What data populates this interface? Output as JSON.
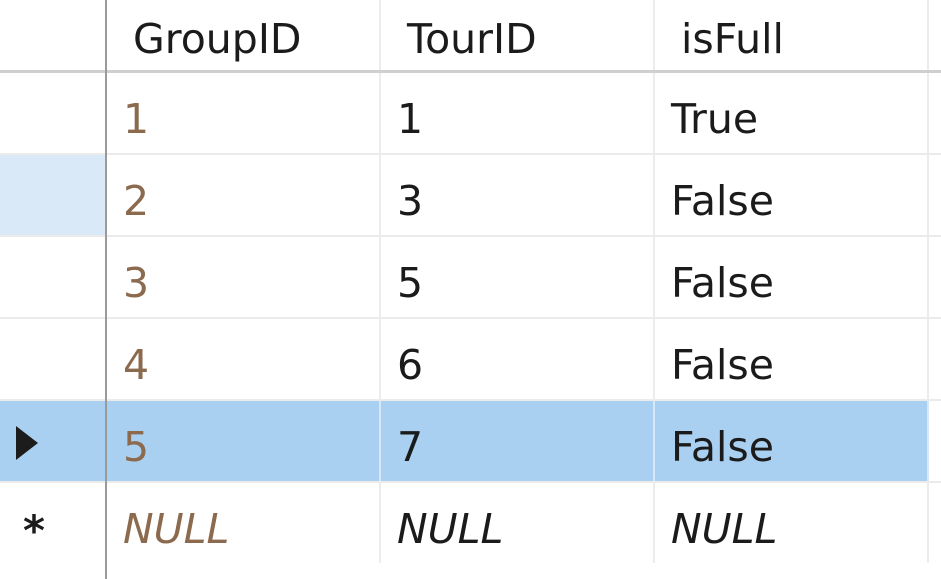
{
  "columns": [
    "GroupID",
    "TourID",
    "isFull"
  ],
  "rows": [
    {
      "group_id": "1",
      "tour_id": "1",
      "is_full": "True"
    },
    {
      "group_id": "2",
      "tour_id": "3",
      "is_full": "False"
    },
    {
      "group_id": "3",
      "tour_id": "5",
      "is_full": "False"
    },
    {
      "group_id": "4",
      "tour_id": "6",
      "is_full": "False"
    },
    {
      "group_id": "5",
      "tour_id": "7",
      "is_full": "False"
    }
  ],
  "new_row": {
    "group_id": "NULL",
    "tour_id": "NULL",
    "is_full": "NULL",
    "marker": "*"
  },
  "colors": {
    "selection": "#a9d0f0",
    "row_highlight": "#d9e9f7",
    "id_text": "#8b6a4e"
  },
  "icons": {
    "current_row": "row-pointer-arrow-icon",
    "new_row": "new-row-asterisk-icon"
  }
}
